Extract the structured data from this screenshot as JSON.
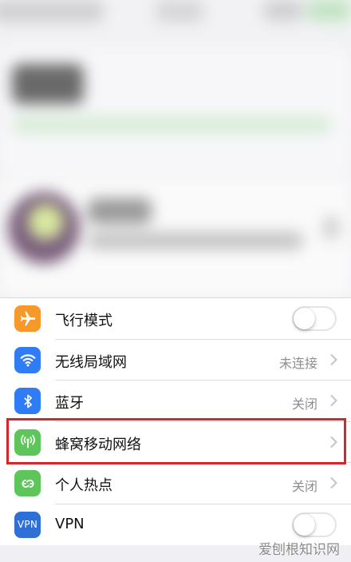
{
  "settings": {
    "items": [
      {
        "label": "飞行模式",
        "value": "",
        "icon": "airplane-icon",
        "color": "#f7982b",
        "control": "toggle",
        "toggle_on": false
      },
      {
        "label": "无线局域网",
        "value": "未连接",
        "icon": "wifi-icon",
        "color": "#2f7cf6",
        "control": "chevron"
      },
      {
        "label": "蓝牙",
        "value": "关闭",
        "icon": "bluetooth-icon",
        "color": "#2f7cf6",
        "control": "chevron"
      },
      {
        "label": "蜂窝移动网络",
        "value": "",
        "icon": "antenna-icon",
        "color": "#5ec55a",
        "control": "chevron"
      },
      {
        "label": "个人热点",
        "value": "关闭",
        "icon": "hotspot-icon",
        "color": "#5ec55a",
        "control": "chevron"
      },
      {
        "label": "VPN",
        "value": "",
        "icon": "vpn-icon",
        "icon_text": "VPN",
        "color": "#2f6fd6",
        "control": "toggle",
        "toggle_on": false
      }
    ]
  },
  "highlight_color": "#d9242a",
  "watermark": "爱刨根知识网"
}
